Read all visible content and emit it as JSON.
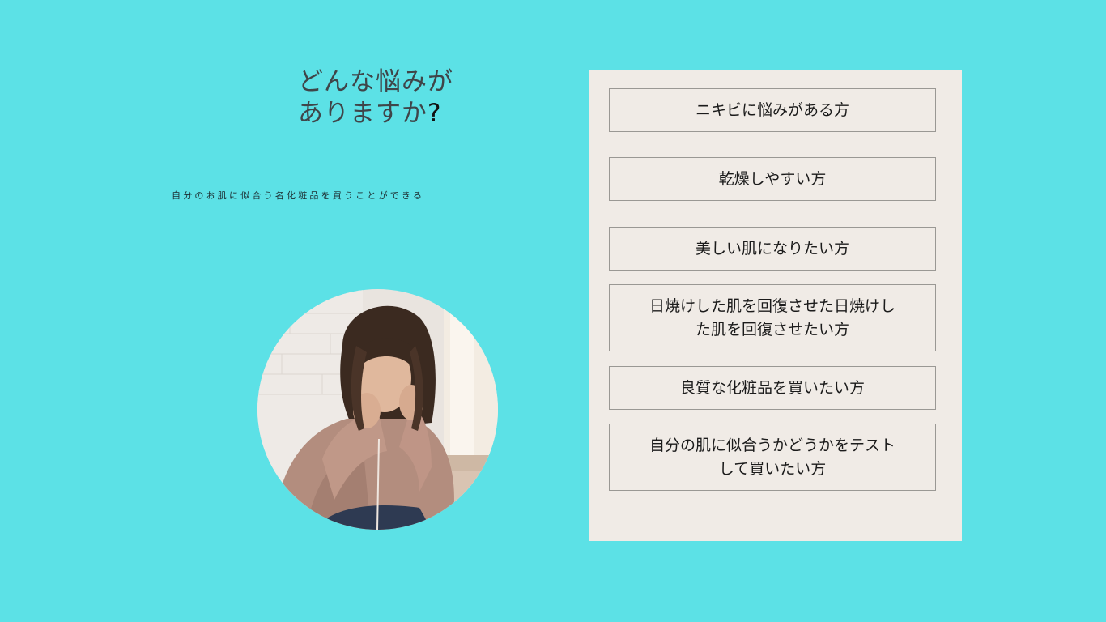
{
  "colors": {
    "background": "#5ce1e6",
    "panel": "#f0ebe6",
    "headline_text": "#3f4549",
    "headline_question_mark": "#111111",
    "subtext": "#1c2c30",
    "option_border": "#9a9894"
  },
  "hero": {
    "headline_line1": "どんな悩みが",
    "headline_line2": "ありますか",
    "headline_mark": "?",
    "subtext": "自分のお肌に似合う名化粧品を買うことができる",
    "image_icon": "worried-woman-photo"
  },
  "options": [
    {
      "lines": [
        "ニキビに悩みがある方"
      ]
    },
    {
      "lines": [
        "乾燥しやすい方"
      ]
    },
    {
      "lines": [
        "美しい肌になりたい方"
      ]
    },
    {
      "lines": [
        "日焼けした肌を回復させた日焼けし",
        "た肌を回復させたい方"
      ]
    },
    {
      "lines": [
        "良質な化粧品を買いたい方"
      ]
    },
    {
      "lines": [
        "自分の肌に似合うかどうかをテスト",
        "して買いたい方"
      ]
    }
  ]
}
